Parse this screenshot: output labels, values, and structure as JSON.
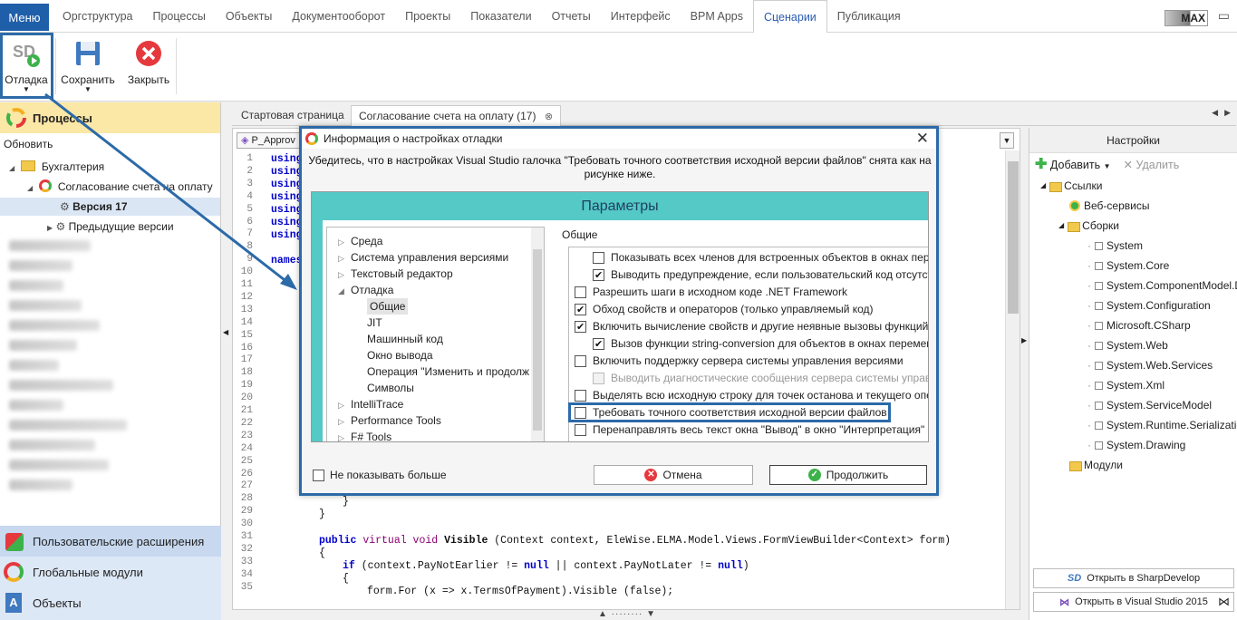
{
  "menubar": {
    "menu_label": "Меню",
    "tabs": [
      "Оргструктура",
      "Процессы",
      "Объекты",
      "Документооборот",
      "Проекты",
      "Показатели",
      "Отчеты",
      "Интерфейс",
      "BPM Apps",
      "Сценарии",
      "Публикация"
    ],
    "active_tab": "Сценарии",
    "user_badge": "MAX"
  },
  "ribbon": {
    "debug_label": "Отладка",
    "save_label": "Сохранить",
    "close_label": "Закрыть"
  },
  "left_panel": {
    "header": "Процессы",
    "refresh": "Обновить",
    "tree": {
      "folder": "Бухгалтерия",
      "process": "Согласование счета на оплату",
      "version": "Версия 17",
      "previous": "Предыдущие версии"
    },
    "bottom": {
      "extensions": "Пользовательские расширения",
      "global_modules": "Глобальные модули",
      "objects": "Объекты"
    }
  },
  "doc_tabs": {
    "start": "Стартовая страница",
    "current": "Согласование счета на оплату (17)"
  },
  "editor": {
    "class_combo": "P_Approv",
    "line_numbers": [
      "1",
      "2",
      "3",
      "4",
      "5",
      "6",
      "7",
      "8",
      "9",
      "10",
      "11",
      "12",
      "13",
      "14",
      "15",
      "16",
      "17",
      "18",
      "19",
      "20",
      "21",
      "22",
      "23",
      "24",
      "25",
      "26",
      "27",
      "28",
      "29",
      "30",
      "31",
      "32",
      "33",
      "34",
      "35"
    ],
    "code_lines": {
      "using": "using",
      "namespace": "names",
      "brace_close": "}",
      "brace_close2": "}",
      "l31_kw1": "public",
      "l31_kw2": "virtual",
      "l31_kw3": "void",
      "l31_name": "Visible",
      "l31_rest": "(Context context, EleWise.ELMA.Model.Views.FormViewBuilder<Context> form)",
      "l32": "{",
      "l33_kw": "if",
      "l33_a": "(context.PayNotEarlier != ",
      "l33_null1": "null",
      "l33_b": " || context.PayNotLater != ",
      "l33_null2": "null",
      "l33_c": ")",
      "l34": "{",
      "l35": "form.For (x => x.TermsOfPayment).Visible (false);"
    }
  },
  "right_panel": {
    "header": "Настройки",
    "add": "Добавить",
    "delete": "Удалить",
    "links": "Ссылки",
    "web_services": "Веб-сервисы",
    "assemblies": "Сборки",
    "assembly_items": [
      "System",
      "System.Core",
      "System.ComponentModel.D",
      "System.Configuration",
      "Microsoft.CSharp",
      "System.Web",
      "System.Web.Services",
      "System.Xml",
      "System.ServiceModel",
      "System.Runtime.Serializatio",
      "System.Drawing"
    ],
    "modules": "Модули",
    "open_sharpdevelop": "Открыть в SharpDevelop",
    "open_vs": "Открыть в Visual Studio 2015"
  },
  "dialog": {
    "title": "Информация о настройках отладки",
    "message": "Убедитесь, что в настройках Visual Studio галочка \"Требовать точного соответствия исходной версии файлов\" снята как на рисунке ниже.",
    "params_title": "Параметры",
    "tree": [
      "Среда",
      "Система управления версиями",
      "Текстовый редактор",
      "Отладка",
      "Общие",
      "JIT",
      "Машинный код",
      "Окно вывода",
      "Операция \"Изменить и продолж",
      "Символы",
      "IntelliTrace",
      "Performance Tools",
      "F# Tools"
    ],
    "general_label": "Общие",
    "options": [
      {
        "text": "Показывать всех членов для встроенных объектов в окнах пере",
        "checked": false,
        "disabled": false
      },
      {
        "text": "Выводить предупреждение, если пользовательский код отсутст",
        "checked": true,
        "disabled": false
      },
      {
        "text": "Разрешить шаги в исходном коде .NET Framework",
        "checked": false,
        "disabled": false
      },
      {
        "text": "Обход свойств и операторов (только управляемый код)",
        "checked": true,
        "disabled": false
      },
      {
        "text": "Включить вычисление свойств и другие неявные вызовы функций",
        "checked": true,
        "disabled": false
      },
      {
        "text": "Вызов функции string-conversion для объектов в окнах перемен",
        "checked": true,
        "disabled": false
      },
      {
        "text": "Включить поддержку сервера системы управления версиями",
        "checked": false,
        "disabled": false
      },
      {
        "text": "Выводить диагностические сообщения сервера системы управ",
        "checked": false,
        "disabled": true
      },
      {
        "text": "Выделять всю исходную строку для точек останова и текущего опе",
        "checked": false,
        "disabled": false
      },
      {
        "text": "Требовать точного соответствия исходной версии файлов",
        "checked": false,
        "disabled": false
      },
      {
        "text": "Перенаправлять весь текст окна \"Вывод\" в окно \"Интерпретация\"",
        "checked": false,
        "disabled": false
      }
    ],
    "dont_show": "Не показывать больше",
    "cancel": "Отмена",
    "continue": "Продолжить"
  },
  "colors": {
    "accent": "#2c6aa8",
    "menu_bg": "#1f5fa9",
    "params_header": "#54c9c6",
    "left_header": "#fbe7a6"
  }
}
